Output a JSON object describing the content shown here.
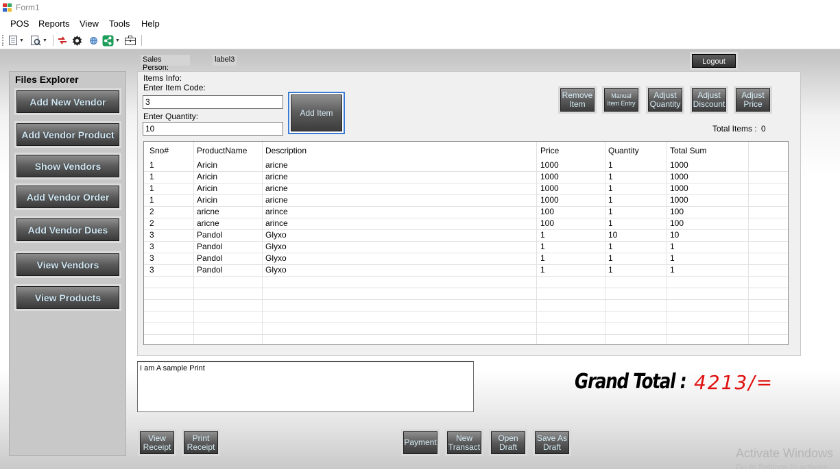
{
  "window": {
    "title": "Form1"
  },
  "menu": {
    "items": [
      "POS",
      "Reports",
      "View",
      "Tools",
      "Help"
    ]
  },
  "toolbar": {
    "icons": [
      "document-icon",
      "search-document-icon",
      "sync-icon",
      "gear-icon",
      "globe-icon",
      "share-icon",
      "briefcase-icon"
    ]
  },
  "header": {
    "sales_person_label": "Sales Person:",
    "sales_person_value": "label3",
    "logout_label": "Logout"
  },
  "sidebar": {
    "title": "Files Explorer",
    "buttons": [
      "Add New Vendor",
      "Add Vendor Product",
      "Show Vendors",
      "Add Vendor Order",
      "Add Vendor Dues",
      "View Vendors",
      "View Products"
    ]
  },
  "items_info": {
    "group_label": "Items Info:",
    "item_code_label": "Enter Item Code:",
    "item_code_value": "3",
    "quantity_label": "Enter Quantity:",
    "quantity_value": "10",
    "add_item_label": "Add Item"
  },
  "actions": {
    "remove_item": [
      "Remove",
      "Item"
    ],
    "manual_entry": [
      "Manual",
      "Item Entry"
    ],
    "adjust_quantity": [
      "Adjust",
      "Quantity"
    ],
    "adjust_discount": [
      "Adjust",
      "Discount"
    ],
    "adjust_price": [
      "Adjust",
      "Price"
    ]
  },
  "totals": {
    "total_items_label": "Total Items :",
    "total_items_value": "0",
    "grand_total_label": "Grand Total :",
    "grand_total_value": "4213/="
  },
  "table": {
    "columns": [
      "Sno#",
      "ProductName",
      "Description",
      "Price",
      "Quantity",
      "Total Sum"
    ],
    "rows": [
      [
        "1",
        "Aricin",
        "aricne",
        "1000",
        "1",
        "1000"
      ],
      [
        "1",
        "Aricin",
        "aricne",
        "1000",
        "1",
        "1000"
      ],
      [
        "1",
        "Aricin",
        "aricne",
        "1000",
        "1",
        "1000"
      ],
      [
        "1",
        "Aricin",
        "aricne",
        "1000",
        "1",
        "1000"
      ],
      [
        "2",
        "aricne",
        "arince",
        "100",
        "1",
        "100"
      ],
      [
        "2",
        "aricne",
        "arince",
        "100",
        "1",
        "100"
      ],
      [
        "3",
        "Pandol",
        "Glyxo",
        "1",
        "10",
        "10"
      ],
      [
        "3",
        "Pandol",
        "Glyxo",
        "1",
        "1",
        "1"
      ],
      [
        "3",
        "Pandol",
        "Glyxo",
        "1",
        "1",
        "1"
      ],
      [
        "3",
        "Pandol",
        "Glyxo",
        "1",
        "1",
        "1"
      ]
    ]
  },
  "print_preview": {
    "text": "I am A sample Print"
  },
  "bottom_buttons": {
    "view_receipt": [
      "View",
      "Receipt"
    ],
    "print_receipt": [
      "Print",
      "Receipt"
    ],
    "payment": [
      "Payment"
    ],
    "new_transaction": [
      "New",
      "Transact"
    ],
    "open_draft": [
      "Open",
      "Draft"
    ],
    "save_as_draft": [
      "Save As",
      "Draft"
    ]
  },
  "watermark": {
    "line1": "Activate Windows",
    "line2": "Go to Settings to activate"
  }
}
